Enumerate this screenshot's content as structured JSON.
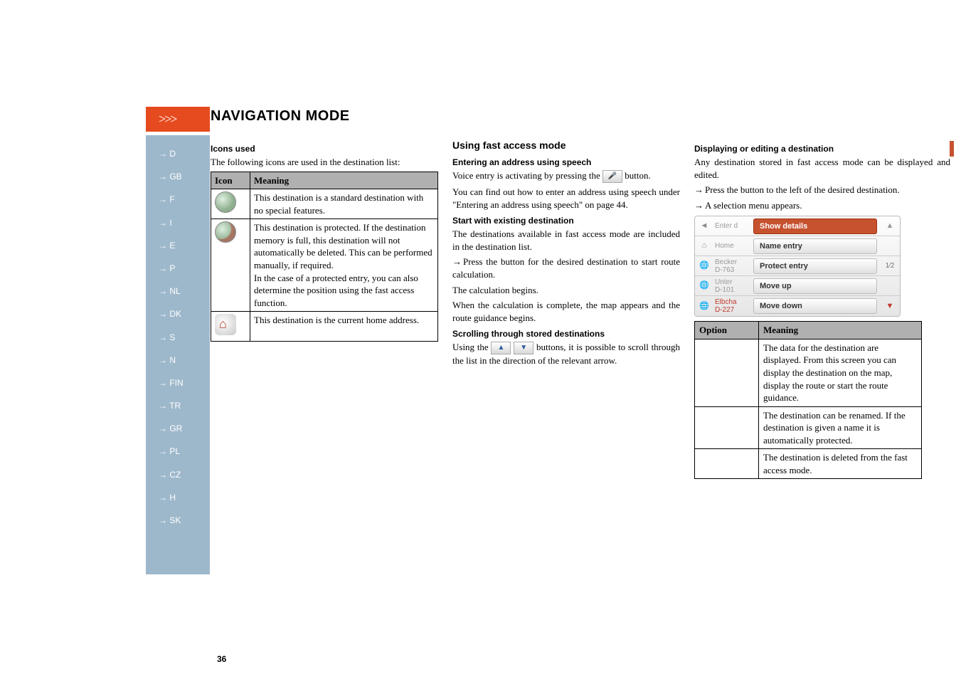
{
  "header": {
    "arrows": ">>>",
    "title": "NAVIGATION MODE"
  },
  "sidebar": {
    "items": [
      "→ D",
      "→ GB",
      "→ F",
      "→ I",
      "→ E",
      "→ P",
      "→ NL",
      "→ DK",
      "→ S",
      "→ N",
      "→ FIN",
      "→ TR",
      "→ GR",
      "→ PL",
      "→ CZ",
      "→ H",
      "→ SK"
    ]
  },
  "col1": {
    "h_icons": "Icons used",
    "intro": "The following icons are used in the destination list:",
    "th_icon": "Icon",
    "th_meaning": "Meaning",
    "row1": "This destination is a standard destination with no special features.",
    "row2": "This destination is protected. If the destination memory is full, this destination will not automatically be deleted. This can be performed manually, if required.\nIn the case of a protected entry, you can also determine the position using the fast access function.",
    "row3": "This destination is the current home address."
  },
  "col2": {
    "h_fast": "Using fast access mode",
    "h_speech": "Entering an address using speech",
    "p_speech1": "Voice entry is activating by pressing the",
    "p_speech1b": "button.",
    "p_speech2": "You can find out how to enter an address using speech under \"Entering an address using speech\" on page 44.",
    "h_start": "Start with existing destination",
    "p_start1": "The destinations available in fast access mode are included in the destination list.",
    "li_start": "Press the button for the desired destination to start route calculation.",
    "p_start2": "The calculation begins.",
    "p_start3": "When the calculation is complete, the map appears and the route guidance begins.",
    "h_scroll": "Scrolling through stored destinations",
    "p_scroll1a": "Using the",
    "p_scroll1b": "buttons, it is possible to scroll through the list in the direction of the relevant arrow."
  },
  "col3": {
    "h_disp": "Displaying or editing a destination",
    "p_disp1": "Any destination stored in fast access mode can be displayed and edited.",
    "li_disp1": "Press the button to the left of the desired destination.",
    "li_disp2": "A selection menu appears.",
    "menu": {
      "r1": {
        "c2a": "Enter d",
        "c3": "Show details"
      },
      "r2": {
        "c2a": "Home",
        "c3": "Name entry"
      },
      "r3": {
        "c2a": "Becker",
        "c2b": "D-763",
        "c3": "Protect entry",
        "frac": "1⁄2"
      },
      "r4": {
        "c2a": "Unter",
        "c2b": "D-101",
        "c3": "Move up"
      },
      "r5": {
        "c2a": "Elbcha",
        "c2b": "D-227",
        "c3": "Move down"
      }
    },
    "th_option": "Option",
    "th_meaning": "Meaning",
    "opt1": "The data for the destination are displayed. From this screen you can display the destination on the map, display the route or start the route guidance.",
    "opt2": "The destination can be renamed. If the destination is given a name it is automatically protected.",
    "opt3": "The destination is deleted from the fast access mode."
  },
  "page": "36"
}
